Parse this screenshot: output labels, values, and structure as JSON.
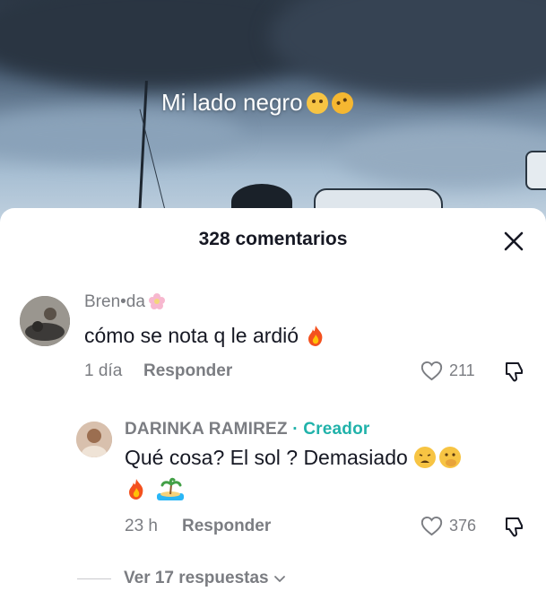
{
  "video": {
    "overlay_text": "Mi lado negro"
  },
  "comments_sheet": {
    "title": "328 comentarios",
    "comments": [
      {
        "username": "Bren•da",
        "text": "cómo se nota q le ardió",
        "time": "1 día",
        "reply_label": "Responder",
        "likes": "211"
      }
    ],
    "reply": {
      "username": "DARINKA RAMIREZ",
      "separator": "·",
      "creator_badge": "Creador",
      "text_line1": "Qué cosa? El sol ? Demasiado",
      "time": "23 h",
      "reply_label": "Responder",
      "likes": "376"
    },
    "view_replies": "Ver 17 respuestas"
  },
  "colors": {
    "text_primary": "#161823",
    "text_secondary": "#7b7d82",
    "creator_accent": "#20b2aa",
    "sheet_bg": "#ffffff"
  },
  "icons": [
    "close-icon",
    "heart-icon",
    "dislike-icon",
    "chevron-down-icon",
    "fire-emoji",
    "island-emoji",
    "flower-emoji",
    "hushed-emoji",
    "rofl-emoji",
    "weary-emoji"
  ]
}
